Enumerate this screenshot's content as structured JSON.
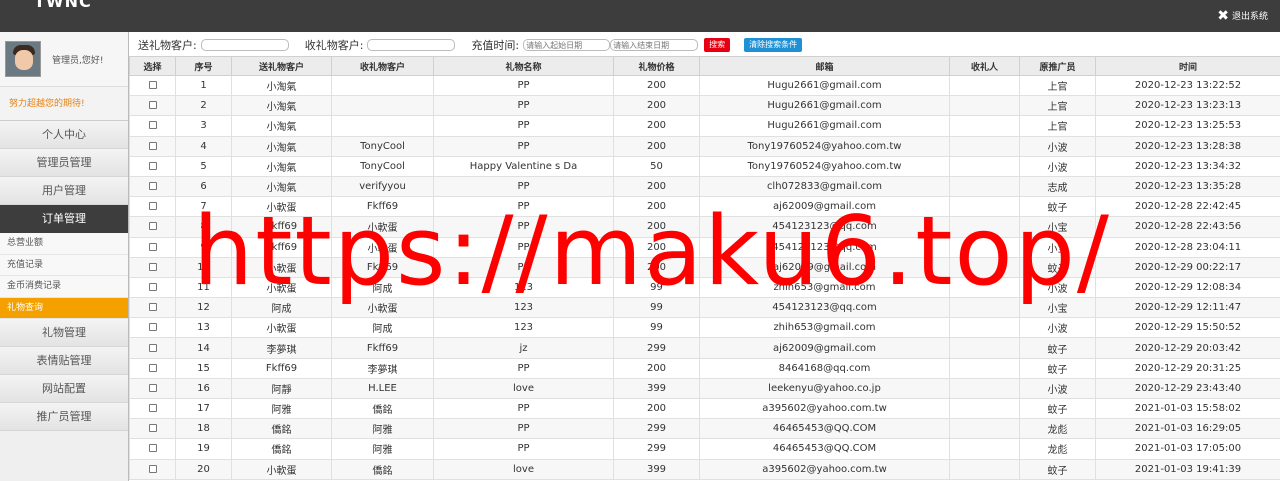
{
  "header": {
    "brand": "TWNC",
    "logout_label": "退出系统"
  },
  "sidebar": {
    "greeting": "管理员,您好!",
    "motto": "努力超越您的期待!",
    "menu": [
      {
        "label": "个人中心"
      },
      {
        "label": "管理员管理"
      },
      {
        "label": "用户管理"
      },
      {
        "label": "订单管理",
        "active": true,
        "sub": [
          {
            "label": "总营业额"
          },
          {
            "label": "充值记录"
          },
          {
            "label": "金币消费记录"
          },
          {
            "label": "礼物查询",
            "active": true
          }
        ]
      },
      {
        "label": "礼物管理"
      },
      {
        "label": "表情贴管理"
      },
      {
        "label": "网站配置"
      },
      {
        "label": "推广员管理"
      }
    ]
  },
  "filters": {
    "sender_label": "送礼物客户:",
    "sender_value": "",
    "receiver_label": "收礼物客户:",
    "receiver_value": "",
    "time_label": "充值时间:",
    "start_placeholder": "请输入起始日期",
    "end_placeholder": "请输入结束日期",
    "search_label": "搜索",
    "clear_label": "清除搜索条件",
    "search_color": "#e60012",
    "clear_color": "#1e90d6"
  },
  "table": {
    "columns": [
      "选择",
      "序号",
      "送礼物客户",
      "收礼物客户",
      "礼物名称",
      "礼物价格",
      "邮箱",
      "收礼人",
      "原推广员",
      "时间"
    ],
    "rows": [
      [
        "1",
        "小淘氣",
        "",
        "PP",
        "200",
        "Hugu2661@gmail.com",
        "",
        "上官",
        "2020-12-23 13:22:52"
      ],
      [
        "2",
        "小淘氣",
        "",
        "PP",
        "200",
        "Hugu2661@gmail.com",
        "",
        "上官",
        "2020-12-23 13:23:13"
      ],
      [
        "3",
        "小淘氣",
        "",
        "PP",
        "200",
        "Hugu2661@gmail.com",
        "",
        "上官",
        "2020-12-23 13:25:53"
      ],
      [
        "4",
        "小淘氣",
        "TonyCool",
        "PP",
        "200",
        "Tony19760524@yahoo.com.tw",
        "",
        "小波",
        "2020-12-23 13:28:38"
      ],
      [
        "5",
        "小淘氣",
        "TonyCool",
        "Happy Valentine s Da",
        "50",
        "Tony19760524@yahoo.com.tw",
        "",
        "小波",
        "2020-12-23 13:34:32"
      ],
      [
        "6",
        "小淘氣",
        "verifyyou",
        "PP",
        "200",
        "clh072833@gmail.com",
        "",
        "志成",
        "2020-12-23 13:35:28"
      ],
      [
        "7",
        "小軟蛋",
        "Fkff69",
        "PP",
        "200",
        "aj62009@gmail.com",
        "",
        "蚊子",
        "2020-12-28 22:42:45"
      ],
      [
        "8",
        "Fkff69",
        "小軟蛋",
        "PP",
        "200",
        "454123123@qq.com",
        "",
        "小宝",
        "2020-12-28 22:43:56"
      ],
      [
        "9",
        "Fkff69",
        "小軟蛋",
        "PP",
        "200",
        "454123123@qq.com",
        "",
        "小宝",
        "2020-12-28 23:04:11"
      ],
      [
        "10",
        "小軟蛋",
        "Fkff69",
        "PP",
        "200",
        "aj62009@gmail.com",
        "",
        "蚊子",
        "2020-12-29 00:22:17"
      ],
      [
        "11",
        "小軟蛋",
        "阿成",
        "123",
        "99",
        "zhih653@gmail.com",
        "",
        "小波",
        "2020-12-29 12:08:34"
      ],
      [
        "12",
        "阿成",
        "小軟蛋",
        "123",
        "99",
        "454123123@qq.com",
        "",
        "小宝",
        "2020-12-29 12:11:47"
      ],
      [
        "13",
        "小軟蛋",
        "阿成",
        "123",
        "99",
        "zhih653@gmail.com",
        "",
        "小波",
        "2020-12-29 15:50:52"
      ],
      [
        "14",
        "李夢琪",
        "Fkff69",
        "jz",
        "299",
        "aj62009@gmail.com",
        "",
        "蚊子",
        "2020-12-29 20:03:42"
      ],
      [
        "15",
        "Fkff69",
        "李夢琪",
        "PP",
        "200",
        "8464168@qq.com",
        "",
        "蚊子",
        "2020-12-29 20:31:25"
      ],
      [
        "16",
        "阿靜",
        "H.LEE",
        "love",
        "399",
        "leekenyu@yahoo.co.jp",
        "",
        "小波",
        "2020-12-29 23:43:40"
      ],
      [
        "17",
        "阿雅",
        "僑銘",
        "PP",
        "200",
        "a395602@yahoo.com.tw",
        "",
        "蚊子",
        "2021-01-03 15:58:02"
      ],
      [
        "18",
        "僑銘",
        "阿雅",
        "PP",
        "299",
        "46465453@QQ.COM",
        "",
        "龙彪",
        "2021-01-03 16:29:05"
      ],
      [
        "19",
        "僑銘",
        "阿雅",
        "PP",
        "299",
        "46465453@QQ.COM",
        "",
        "龙彪",
        "2021-01-03 17:05:00"
      ],
      [
        "20",
        "小軟蛋",
        "僑銘",
        "love",
        "399",
        "a395602@yahoo.com.tw",
        "",
        "蚊子",
        "2021-01-03 19:41:39"
      ]
    ]
  },
  "watermark": "https://maku6.top/"
}
